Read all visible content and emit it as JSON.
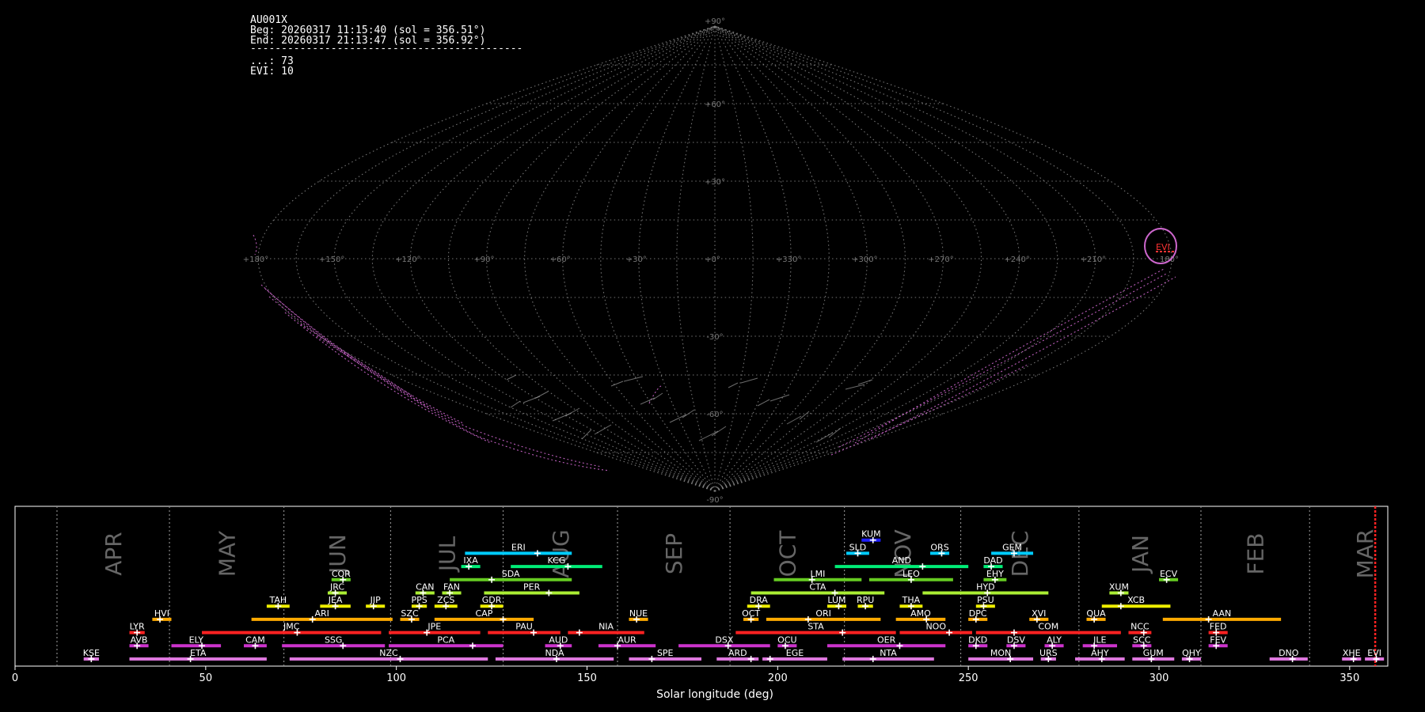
{
  "info": {
    "station": "AU001X",
    "beg": "Beg: 20260317 11:15:40 (sol = 356.51°)",
    "end": "End: 20260317 21:13:47 (sol = 356.92°)",
    "separator": "--------------------------------------------",
    "count_line": "...: 73",
    "evi_line": "EVI: 10"
  },
  "sky_map": {
    "projection": "sinusoidal",
    "lon_tick_labels": [
      "+180°",
      "+150°",
      "+120°",
      "+90°",
      "+60°",
      "+30°",
      "+0°",
      "+330°",
      "+300°",
      "+270°",
      "+240°",
      "+210°",
      "180°"
    ],
    "lat_tick_labels": [
      "+90°",
      "+60°",
      "+30°",
      "-30°",
      "-60°",
      "-90°"
    ],
    "radiant_label": "EVI",
    "colors": {
      "grid": "#888888",
      "meteor_trails": "#cc66cc",
      "radiant": "#ff3333"
    }
  },
  "chart_data": {
    "type": "bar",
    "title": "",
    "xlabel": "Solar longitude (deg)",
    "xlim": [
      0,
      360
    ],
    "x_ticks": [
      "0",
      "50",
      "100",
      "150",
      "200",
      "250",
      "300",
      "350"
    ],
    "months": [
      "APR",
      "MAY",
      "JUN",
      "JUL",
      "AUG",
      "SEP",
      "OCT",
      "NOV",
      "DEC",
      "JAN",
      "FEB",
      "MAR"
    ],
    "month_boundaries": [
      11,
      40.5,
      70.5,
      98.5,
      128,
      158,
      187.5,
      217.5,
      248,
      279,
      311,
      339.5
    ],
    "current_sol": 356.7,
    "showers": [
      {
        "code": "KUM",
        "start": 222,
        "end": 227,
        "peak": 225,
        "row": 9,
        "color": "#1e1eff"
      },
      {
        "code": "ERI",
        "start": 118,
        "end": 146,
        "peak": 137,
        "row": 8,
        "color": "#00ccff"
      },
      {
        "code": "SLD",
        "start": 218,
        "end": 224,
        "peak": 221,
        "row": 8,
        "color": "#00ccff"
      },
      {
        "code": "ORS",
        "start": 240,
        "end": 245,
        "peak": 243,
        "row": 8,
        "color": "#00ccff"
      },
      {
        "code": "GEM",
        "start": 256,
        "end": 267,
        "peak": 262,
        "row": 8,
        "color": "#00ccff"
      },
      {
        "code": "IXA",
        "start": 117,
        "end": 122,
        "peak": 119,
        "row": 7,
        "color": "#00ee77"
      },
      {
        "code": "KCG",
        "start": 130,
        "end": 154,
        "peak": 145,
        "row": 7,
        "color": "#00ee77"
      },
      {
        "code": "AND",
        "start": 215,
        "end": 250,
        "peak": 238,
        "row": 7,
        "color": "#00ee77"
      },
      {
        "code": "DAD",
        "start": 254,
        "end": 259,
        "peak": 256,
        "row": 7,
        "color": "#00ee77"
      },
      {
        "code": "COR",
        "start": 83,
        "end": 88,
        "peak": 86,
        "row": 6,
        "color": "#66cc22"
      },
      {
        "code": "SDA",
        "start": 114,
        "end": 146,
        "peak": 125,
        "row": 6,
        "color": "#66cc22"
      },
      {
        "code": "LMI",
        "start": 199,
        "end": 222,
        "peak": 209,
        "row": 6,
        "color": "#66cc22"
      },
      {
        "code": "LEO",
        "start": 224,
        "end": 246,
        "peak": 235,
        "row": 6,
        "color": "#66cc22"
      },
      {
        "code": "EHY",
        "start": 254,
        "end": 260,
        "peak": 257,
        "row": 6,
        "color": "#66cc22"
      },
      {
        "code": "ECV",
        "start": 300,
        "end": 305,
        "peak": 302,
        "row": 6,
        "color": "#66cc22"
      },
      {
        "code": "JRC",
        "start": 82,
        "end": 87,
        "peak": 84,
        "row": 5,
        "color": "#aaee33"
      },
      {
        "code": "CAN",
        "start": 105,
        "end": 110,
        "peak": 107,
        "row": 5,
        "color": "#aaee33"
      },
      {
        "code": "FAN",
        "start": 112,
        "end": 117,
        "peak": 114,
        "row": 5,
        "color": "#aaee33"
      },
      {
        "code": "PER",
        "start": 123,
        "end": 148,
        "peak": 140,
        "row": 5,
        "color": "#aaee33"
      },
      {
        "code": "CTA",
        "start": 193,
        "end": 228,
        "peak": 215,
        "row": 5,
        "color": "#aaee33"
      },
      {
        "code": "HYD",
        "start": 238,
        "end": 271,
        "peak": 255,
        "row": 5,
        "color": "#aaee33"
      },
      {
        "code": "XUM",
        "start": 287,
        "end": 292,
        "peak": 290,
        "row": 5,
        "color": "#aaee33"
      },
      {
        "code": "TAH",
        "start": 66,
        "end": 72,
        "peak": 69,
        "row": 4,
        "color": "#eeee00"
      },
      {
        "code": "JEA",
        "start": 80,
        "end": 88,
        "peak": 84,
        "row": 4,
        "color": "#eeee00"
      },
      {
        "code": "JIP",
        "start": 92,
        "end": 97,
        "peak": 94,
        "row": 4,
        "color": "#eeee00"
      },
      {
        "code": "PPS",
        "start": 104,
        "end": 108,
        "peak": 106,
        "row": 4,
        "color": "#eeee00"
      },
      {
        "code": "ZCS",
        "start": 110,
        "end": 116,
        "peak": 113,
        "row": 4,
        "color": "#eeee00"
      },
      {
        "code": "GDR",
        "start": 122,
        "end": 128,
        "peak": 125,
        "row": 4,
        "color": "#eeee00"
      },
      {
        "code": "DRA",
        "start": 192,
        "end": 198,
        "peak": 195,
        "row": 4,
        "color": "#eeee00"
      },
      {
        "code": "LUM",
        "start": 213,
        "end": 218,
        "peak": 216,
        "row": 4,
        "color": "#eeee00"
      },
      {
        "code": "RPU",
        "start": 221,
        "end": 225,
        "peak": 223,
        "row": 4,
        "color": "#eeee00"
      },
      {
        "code": "THA",
        "start": 232,
        "end": 238,
        "peak": 235,
        "row": 4,
        "color": "#eeee00"
      },
      {
        "code": "PSU",
        "start": 252,
        "end": 257,
        "peak": 254,
        "row": 4,
        "color": "#eeee00"
      },
      {
        "code": "XCB",
        "start": 285,
        "end": 303,
        "peak": 290,
        "row": 4,
        "color": "#eeee00"
      },
      {
        "code": "HVI",
        "start": 36,
        "end": 41,
        "peak": 38,
        "row": 3,
        "color": "#ffaa00"
      },
      {
        "code": "ARI",
        "start": 62,
        "end": 99,
        "peak": 78,
        "row": 3,
        "color": "#ffaa00"
      },
      {
        "code": "SZC",
        "start": 101,
        "end": 106,
        "peak": 104,
        "row": 3,
        "color": "#ffaa00"
      },
      {
        "code": "CAP",
        "start": 110,
        "end": 136,
        "peak": 128,
        "row": 3,
        "color": "#ffaa00"
      },
      {
        "code": "NUE",
        "start": 161,
        "end": 166,
        "peak": 163,
        "row": 3,
        "color": "#ffaa00"
      },
      {
        "code": "OCT",
        "start": 191,
        "end": 195,
        "peak": 193,
        "row": 3,
        "color": "#ffaa00"
      },
      {
        "code": "ORI",
        "start": 197,
        "end": 227,
        "peak": 208,
        "row": 3,
        "color": "#ffaa00"
      },
      {
        "code": "AMO",
        "start": 231,
        "end": 244,
        "peak": 239,
        "row": 3,
        "color": "#ffaa00"
      },
      {
        "code": "DPC",
        "start": 250,
        "end": 255,
        "peak": 252,
        "row": 3,
        "color": "#ffaa00"
      },
      {
        "code": "XVI",
        "start": 266,
        "end": 271,
        "peak": 268,
        "row": 3,
        "color": "#ffaa00"
      },
      {
        "code": "QUA",
        "start": 281,
        "end": 286,
        "peak": 283,
        "row": 3,
        "color": "#ffaa00"
      },
      {
        "code": "AAN",
        "start": 301,
        "end": 332,
        "peak": 313,
        "row": 3,
        "color": "#ffaa00"
      },
      {
        "code": "LYR",
        "start": 30,
        "end": 34,
        "peak": 32,
        "row": 2,
        "color": "#ff2222"
      },
      {
        "code": "JMC",
        "start": 49,
        "end": 96,
        "peak": 74,
        "row": 2,
        "color": "#ff2222"
      },
      {
        "code": "JPE",
        "start": 98,
        "end": 122,
        "peak": 108,
        "row": 2,
        "color": "#ff2222"
      },
      {
        "code": "PAU",
        "start": 124,
        "end": 143,
        "peak": 136,
        "row": 2,
        "color": "#ff2222"
      },
      {
        "code": "NIA",
        "start": 145,
        "end": 165,
        "peak": 148,
        "row": 2,
        "color": "#ff2222"
      },
      {
        "code": "STA",
        "start": 189,
        "end": 231,
        "peak": 217,
        "row": 2,
        "color": "#ff2222"
      },
      {
        "code": "NOO",
        "start": 232,
        "end": 251,
        "peak": 245,
        "row": 2,
        "color": "#ff2222"
      },
      {
        "code": "COM",
        "start": 252,
        "end": 290,
        "peak": 262,
        "row": 2,
        "color": "#ff2222"
      },
      {
        "code": "NCC",
        "start": 292,
        "end": 298,
        "peak": 296,
        "row": 2,
        "color": "#ff2222"
      },
      {
        "code": "FED",
        "start": 313,
        "end": 318,
        "peak": 315,
        "row": 2,
        "color": "#ff2222"
      },
      {
        "code": "AVB",
        "start": 30,
        "end": 35,
        "peak": 32,
        "row": 1,
        "color": "#cc33cc"
      },
      {
        "code": "ELY",
        "start": 41,
        "end": 54,
        "peak": 49,
        "row": 1,
        "color": "#cc33cc"
      },
      {
        "code": "CAM",
        "start": 60,
        "end": 66,
        "peak": 63,
        "row": 1,
        "color": "#cc33cc"
      },
      {
        "code": "SSG",
        "start": 70,
        "end": 97,
        "peak": 86,
        "row": 1,
        "color": "#cc33cc"
      },
      {
        "code": "PCA",
        "start": 98,
        "end": 128,
        "peak": 120,
        "row": 1,
        "color": "#cc33cc"
      },
      {
        "code": "AUD",
        "start": 139,
        "end": 146,
        "peak": 143,
        "row": 1,
        "color": "#cc33cc"
      },
      {
        "code": "AUR",
        "start": 153,
        "end": 168,
        "peak": 158,
        "row": 1,
        "color": "#cc33cc"
      },
      {
        "code": "DSX",
        "start": 174,
        "end": 198,
        "peak": 187,
        "row": 1,
        "color": "#cc33cc"
      },
      {
        "code": "OCU",
        "start": 200,
        "end": 205,
        "peak": 202,
        "row": 1,
        "color": "#cc33cc"
      },
      {
        "code": "OER",
        "start": 213,
        "end": 244,
        "peak": 232,
        "row": 1,
        "color": "#cc33cc"
      },
      {
        "code": "DKD",
        "start": 250,
        "end": 255,
        "peak": 252,
        "row": 1,
        "color": "#cc33cc"
      },
      {
        "code": "DSV",
        "start": 260,
        "end": 265,
        "peak": 262,
        "row": 1,
        "color": "#cc33cc"
      },
      {
        "code": "ALY",
        "start": 270,
        "end": 275,
        "peak": 272,
        "row": 1,
        "color": "#cc33cc"
      },
      {
        "code": "ILE",
        "start": 280,
        "end": 289,
        "peak": 283,
        "row": 1,
        "color": "#cc33cc"
      },
      {
        "code": "SCC",
        "start": 293,
        "end": 298,
        "peak": 296,
        "row": 1,
        "color": "#cc33cc"
      },
      {
        "code": "FEV",
        "start": 313,
        "end": 318,
        "peak": 315,
        "row": 1,
        "color": "#cc33cc"
      },
      {
        "code": "KSE",
        "start": 18,
        "end": 22,
        "peak": 20,
        "row": 0,
        "color": "#dd77dd"
      },
      {
        "code": "ETA",
        "start": 30,
        "end": 66,
        "peak": 46,
        "row": 0,
        "color": "#dd77dd"
      },
      {
        "code": "NZC",
        "start": 72,
        "end": 124,
        "peak": 101,
        "row": 0,
        "color": "#dd77dd"
      },
      {
        "code": "NDA",
        "start": 126,
        "end": 157,
        "peak": 142,
        "row": 0,
        "color": "#dd77dd"
      },
      {
        "code": "SPE",
        "start": 161,
        "end": 180,
        "peak": 167,
        "row": 0,
        "color": "#dd77dd"
      },
      {
        "code": "ARD",
        "start": 184,
        "end": 195,
        "peak": 193,
        "row": 0,
        "color": "#dd77dd"
      },
      {
        "code": "EGE",
        "start": 196,
        "end": 213,
        "peak": 198,
        "row": 0,
        "color": "#dd77dd"
      },
      {
        "code": "NTA",
        "start": 217,
        "end": 241,
        "peak": 225,
        "row": 0,
        "color": "#dd77dd"
      },
      {
        "code": "MON",
        "start": 250,
        "end": 267,
        "peak": 261,
        "row": 0,
        "color": "#dd77dd"
      },
      {
        "code": "URS",
        "start": 269,
        "end": 273,
        "peak": 271,
        "row": 0,
        "color": "#dd77dd"
      },
      {
        "code": "AHY",
        "start": 278,
        "end": 291,
        "peak": 285,
        "row": 0,
        "color": "#dd77dd"
      },
      {
        "code": "GUM",
        "start": 293,
        "end": 304,
        "peak": 298,
        "row": 0,
        "color": "#dd77dd"
      },
      {
        "code": "QHY",
        "start": 306,
        "end": 311,
        "peak": 308,
        "row": 0,
        "color": "#dd77dd"
      },
      {
        "code": "DNO",
        "start": 329,
        "end": 339,
        "peak": 335,
        "row": 0,
        "color": "#dd77dd"
      },
      {
        "code": "XHE",
        "start": 348,
        "end": 353,
        "peak": 351,
        "row": 0,
        "color": "#dd77dd"
      },
      {
        "code": "EVI",
        "start": 354,
        "end": 359,
        "peak": 357,
        "row": 0,
        "color": "#dd77dd"
      }
    ]
  }
}
